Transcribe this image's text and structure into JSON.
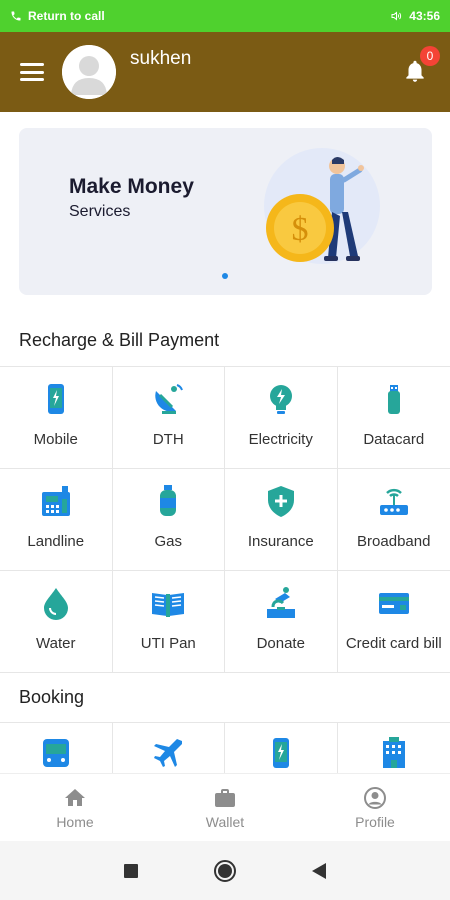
{
  "status_bar": {
    "call_text": "Return to call",
    "time": "43:56"
  },
  "header": {
    "username": "sukhen",
    "notification_count": "0"
  },
  "banner": {
    "title": "Make Money",
    "subtitle": "Services"
  },
  "recharge": {
    "title": "Recharge & Bill Payment",
    "items": [
      {
        "label": "Mobile",
        "icon": "mobile-icon"
      },
      {
        "label": "DTH",
        "icon": "satellite-dish-icon"
      },
      {
        "label": "Electricity",
        "icon": "bulb-icon"
      },
      {
        "label": "Datacard",
        "icon": "usb-icon"
      },
      {
        "label": "Landline",
        "icon": "phone-icon"
      },
      {
        "label": "Gas",
        "icon": "gas-cylinder-icon"
      },
      {
        "label": "Insurance",
        "icon": "shield-icon"
      },
      {
        "label": "Broadband",
        "icon": "router-icon"
      },
      {
        "label": "Water",
        "icon": "water-drop-icon"
      },
      {
        "label": "UTI Pan",
        "icon": "book-icon"
      },
      {
        "label": "Donate",
        "icon": "donate-icon"
      },
      {
        "label": "Credit card bill",
        "icon": "credit-card-icon"
      }
    ]
  },
  "booking": {
    "title": "Booking",
    "items": [
      {
        "icon": "bus-icon"
      },
      {
        "icon": "plane-icon"
      },
      {
        "icon": "mobile-icon"
      },
      {
        "icon": "building-icon"
      }
    ]
  },
  "bottom_nav": {
    "home": "Home",
    "wallet": "Wallet",
    "profile": "Profile"
  },
  "colors": {
    "status_bar": "#4fd12e",
    "header": "#7b5b14",
    "icon_blue": "#1e88e5",
    "icon_teal": "#26a69a"
  }
}
